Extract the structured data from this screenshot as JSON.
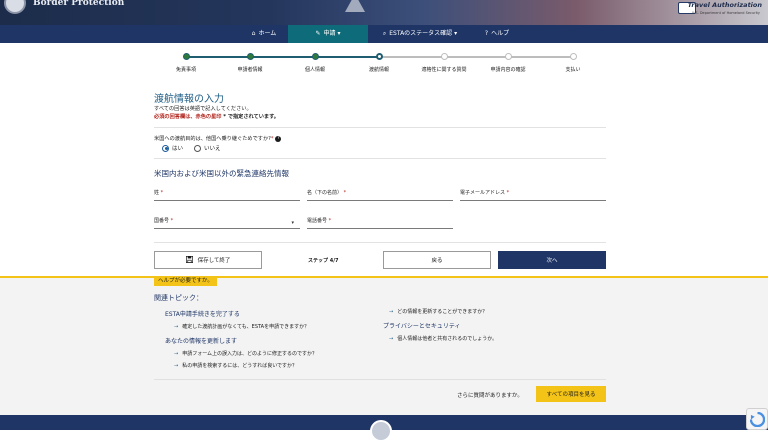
{
  "header": {
    "agency_text": "Border Protection",
    "ta_title": "Travel Authorization",
    "ta_subtitle": "U.S. Department of Homeland Security"
  },
  "nav": {
    "items": [
      {
        "label": "ホーム",
        "icon": "home-icon"
      },
      {
        "label": "申請 ▾",
        "icon": "pen-icon",
        "active": true
      },
      {
        "label": "ESTAのステータス確認 ▾",
        "icon": "search-icon"
      },
      {
        "label": "ヘルプ",
        "icon": "question-icon"
      }
    ]
  },
  "progress": {
    "steps": [
      "免責事項",
      "申請者情報",
      "個人情報",
      "渡航情報",
      "適格性に関する質問",
      "申請内容の確認",
      "支払い"
    ],
    "current_index": 3
  },
  "form": {
    "title": "渡航情報の入力",
    "hint_english": "すべての回答は英語で記入してください。",
    "hint_required_red": "必須の回答欄は、赤色の星印",
    "hint_required_tail": " * で指定されています。",
    "question": "米国への渡航目的は、他国へ乗り継ぐためですか?",
    "question_req": "*",
    "radio_yes": "はい",
    "radio_no": "いいえ",
    "section_title": "米国内および米国以外の緊急連絡先情報",
    "fields": {
      "surname": "姓",
      "given_name": "名（下の名前）",
      "email": "電子メールアドレス",
      "country_code": "国番号",
      "phone": "電話番号"
    },
    "required_mark": " *"
  },
  "buttons": {
    "save_exit": "保存して終了",
    "step_text": "ステップ 4/7",
    "back": "戻る",
    "next": "次へ"
  },
  "help": {
    "tag": "ヘルプが必要ですか。",
    "related": "関連トピック：",
    "topic1": "ESTA申請手続きを完了する",
    "link1": "確定した渡航計画がなくても、ESTAを申請できますか？",
    "topic2": "あなたの情報を更新します",
    "link2": "申請フォーム上の誤入力は、どのように修正するのですか？",
    "link3": "私の申請を検索するには、どうすれば良いですか？",
    "link4": "どの情報を更新することができますか？",
    "topic3": "プライバシーとセキュリティ",
    "link5": "個人情報は他者と共有されるのでしょうか。",
    "more_q": "さらに質問がありますか。",
    "all_items": "すべての項目を見る"
  },
  "colors": {
    "nav_bg": "#1e3566",
    "nav_active": "#0e6c7a",
    "accent_yellow": "#f3c317",
    "title_blue": "#1e5d86",
    "required_red": "#b3261e"
  }
}
